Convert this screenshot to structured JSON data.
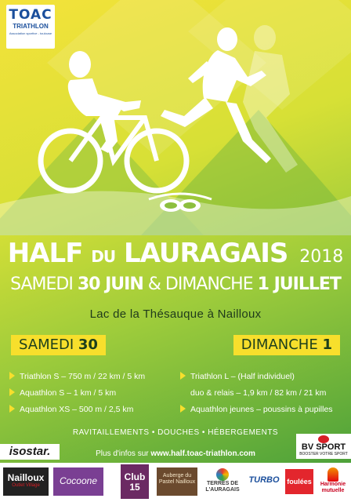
{
  "organizer": {
    "name": "TOAC",
    "sub": "TRIATHLON",
    "line": "Association sportive - toulouse"
  },
  "event": {
    "title_main": "HALF",
    "title_du": "DU",
    "title_place": "LAURAGAIS",
    "year": "2018",
    "date_day1_label": "SAMEDI",
    "date_day1_num": "30 JUIN",
    "date_amp": "&",
    "date_day2_label": "DIMANCHE",
    "date_day2_num": "1 JUILLET",
    "location": "Lac de la Thésauque à Nailloux"
  },
  "days": {
    "left": {
      "label": "SAMEDI",
      "num": "30"
    },
    "right": {
      "label": "DIMANCHE",
      "num": "1"
    }
  },
  "saturday_events": [
    "Triathlon S – 750 m / 22 km / 5 km",
    "Aquathlon S – 1 km / 5 km",
    "Aquathlon XS – 500 m / 2,5 km"
  ],
  "sunday_events": {
    "e1": "Triathlon L – (Half individuel)",
    "e1b": "duo & relais – 1,9 km / 82 km / 21 km",
    "e2": "Aquathlon jeunes – poussins à pupilles"
  },
  "services": "RAVITAILLEMENTS • DOUCHES • HÉBERGEMENTS",
  "info": {
    "prefix": "Plus d'infos sur",
    "url": "www.half.toac-triathlon.com"
  },
  "sponsors": {
    "isostar": "isostar.",
    "bv": "BV SPORT",
    "bv_sub": "BOOSTER VOTRE SPORT",
    "nailloux": "Nailloux",
    "nailloux_sub": "Outlet Village",
    "cocoon": "Cocoone",
    "club15": "Club 15",
    "auberge": "Auberge du Pastel Nailloux",
    "terres": "TERRES DE L'AURAGAIS",
    "turbo": "TURBO",
    "foulees": "foulées",
    "harmonie": "Harmonie mutuelle"
  },
  "colors": {
    "yellow": "#f7df2c",
    "green": "#3f9a3a",
    "dark": "#1d3f1c",
    "blue": "#1b4f9c",
    "red": "#d81f26"
  }
}
